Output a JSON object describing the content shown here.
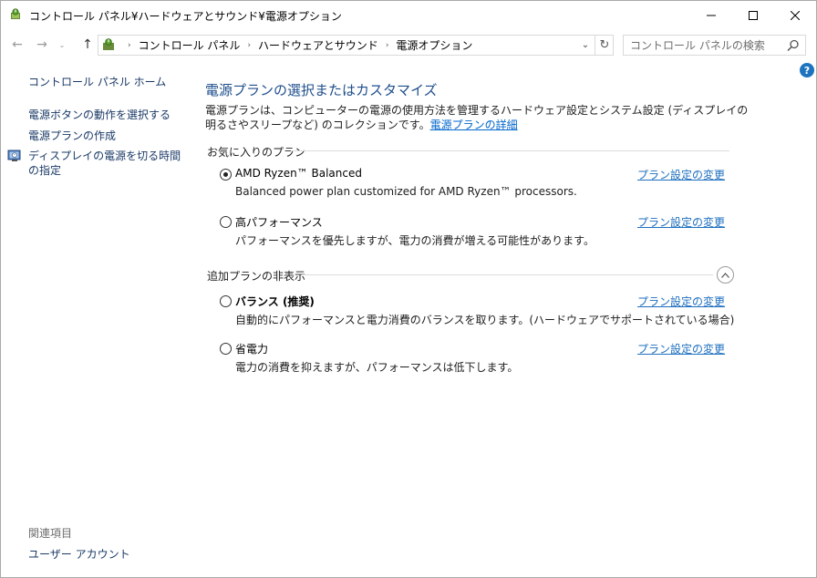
{
  "window": {
    "title": "コントロール パネル¥ハードウェアとサウンド¥電源オプション",
    "icon": "power-options-icon",
    "minimize_glyph": "—",
    "maximize_glyph": "☐",
    "close_glyph": "✕"
  },
  "nav": {
    "back_glyph": "←",
    "forward_glyph": "→",
    "dropdown_glyph": "⌄",
    "up_glyph": "↑",
    "breadcrumb": [
      "コントロール パネル",
      "ハードウェアとサウンド",
      "電源オプション"
    ],
    "separator": "›",
    "refresh_glyph": "↻",
    "search_placeholder": "コントロール パネルの検索"
  },
  "help_glyph": "?",
  "sidebar": {
    "home": "コントロール パネル ホーム",
    "links": [
      "電源ボタンの動作を選択する",
      "電源プランの作成",
      "ディスプレイの電源を切る時間の指定"
    ],
    "see_also_header": "関連項目",
    "see_also": [
      "ユーザー アカウント"
    ]
  },
  "main": {
    "title": "電源プランの選択またはカスタマイズ",
    "description": "電源プランは、コンピューターの電源の使用方法を管理するハードウェア設定とシステム設定 (ディスプレイの明るさやスリープなど) のコレクションです。",
    "details_link": "電源プランの詳細",
    "favorites_header": "お気に入りのプラン",
    "hidden_header": "追加プランの非表示",
    "collapse_glyph": "︿",
    "change_link": "プラン設定の変更",
    "favorite_plans": [
      {
        "name": "AMD Ryzen™ Balanced",
        "desc": "Balanced power plan customized for AMD Ryzen™ processors.",
        "selected": true,
        "bold": false
      },
      {
        "name": "高パフォーマンス",
        "desc": "パフォーマンスを優先しますが、電力の消費が増える可能性があります。",
        "selected": false,
        "bold": false
      }
    ],
    "hidden_plans": [
      {
        "name": "バランス (推奨)",
        "desc": "自動的にパフォーマンスと電力消費のバランスを取ります。(ハードウェアでサポートされている場合)",
        "selected": false,
        "bold": true
      },
      {
        "name": "省電力",
        "desc": "電力の消費を抑えますが、パフォーマンスは低下します。",
        "selected": false,
        "bold": false
      }
    ]
  },
  "colors": {
    "title_blue": "#1e4e8c",
    "link_blue": "#1e6fbf",
    "nav_link": "#1a3a66"
  }
}
